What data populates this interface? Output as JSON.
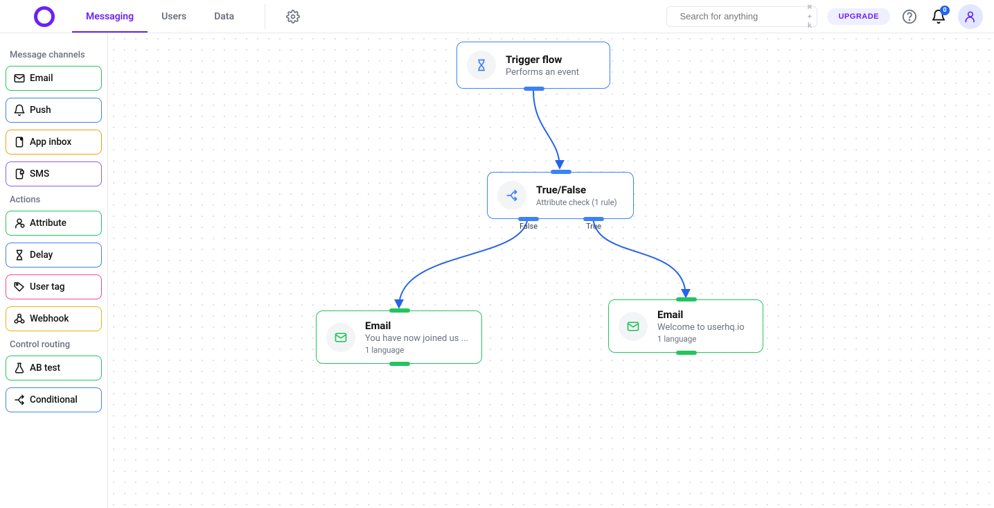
{
  "header": {
    "nav": [
      "Messaging",
      "Users",
      "Data"
    ],
    "active_tab": 0,
    "search_placeholder": "Search for anything",
    "search_shortcut": "⌘ + k",
    "upgrade_label": "UPGRADE",
    "notification_count": "0"
  },
  "sidebar": {
    "sections": [
      {
        "title": "Message channels",
        "items": [
          {
            "label": "Email",
            "icon": "mail-icon",
            "border": "#22c55e"
          },
          {
            "label": "Push",
            "icon": "bell-icon",
            "border": "#3b82f6"
          },
          {
            "label": "App inbox",
            "icon": "inbox-icon",
            "border": "#f59e0b"
          },
          {
            "label": "SMS",
            "icon": "sms-icon",
            "border": "#8b5cf6"
          }
        ]
      },
      {
        "title": "Actions",
        "items": [
          {
            "label": "Attribute",
            "icon": "attribute-icon",
            "border": "#22c55e"
          },
          {
            "label": "Delay",
            "icon": "hourglass-icon",
            "border": "#3b82f6"
          },
          {
            "label": "User tag",
            "icon": "tag-icon",
            "border": "#ec4899"
          },
          {
            "label": "Webhook",
            "icon": "webhook-icon",
            "border": "#eab308"
          }
        ]
      },
      {
        "title": "Control routing",
        "items": [
          {
            "label": "AB test",
            "icon": "flask-icon",
            "border": "#22c55e"
          },
          {
            "label": "Conditional",
            "icon": "split-icon",
            "border": "#3b82f6"
          }
        ]
      }
    ]
  },
  "canvas": {
    "nodes": {
      "trigger": {
        "title": "Trigger flow",
        "subtitle": "Performs an event",
        "border": "#3b82f6",
        "icon_color": "#3b82f6",
        "port_color": "#3b82f6"
      },
      "condition": {
        "title": "True/False",
        "subtitle": "Attribute check (1 rule)",
        "border": "#3b82f6",
        "icon_color": "#3b82f6",
        "port_color": "#3b82f6",
        "out_labels": {
          "false": "False",
          "true": "True"
        }
      },
      "email_false": {
        "title": "Email",
        "subtitle": "You have now joined us ...",
        "meta": "1 language",
        "border": "#22c55e",
        "icon_color": "#22c55e",
        "port_color": "#22c55e"
      },
      "email_true": {
        "title": "Email",
        "subtitle": "Welcome to userhq.io",
        "meta": "1 language",
        "border": "#22c55e",
        "icon_color": "#22c55e",
        "port_color": "#22c55e"
      }
    }
  }
}
